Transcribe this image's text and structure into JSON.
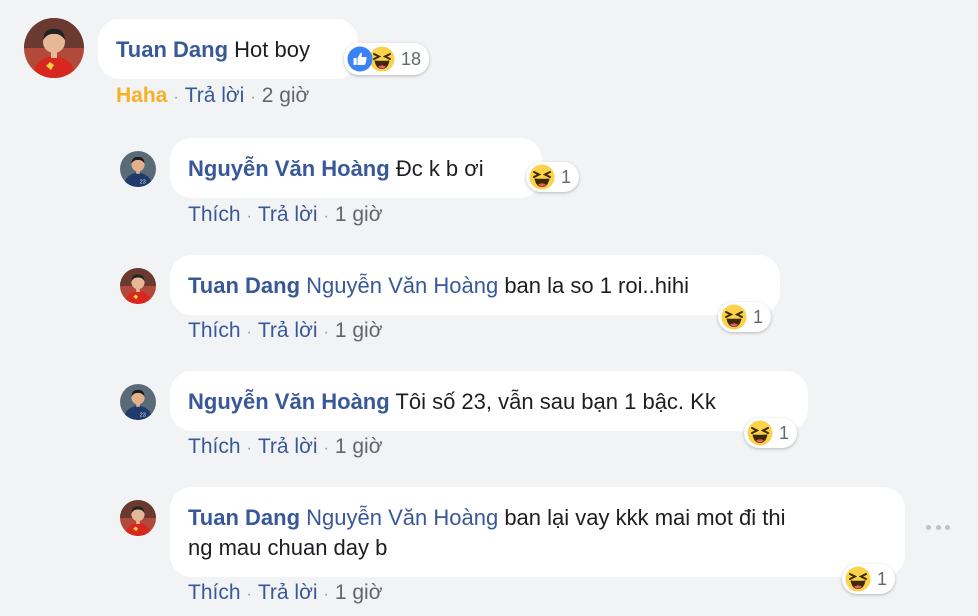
{
  "comment": {
    "author": "Tuan Dang",
    "text": "Hot boy",
    "reaction_count": "18",
    "actions": {
      "react": "Haha",
      "reply": "Trả lời",
      "time": "2 giờ"
    }
  },
  "replies": [
    {
      "author": "Nguyễn Văn Hoàng",
      "mention": "",
      "text": "Đc k b ơi",
      "reaction_count": "1",
      "actions": {
        "like": "Thích",
        "reply": "Trả lời",
        "time": "1 giờ"
      }
    },
    {
      "author": "Tuan Dang",
      "mention": "Nguyễn Văn Hoàng",
      "text": "ban la so 1 roi..hihi",
      "reaction_count": "1",
      "actions": {
        "like": "Thích",
        "reply": "Trả lời",
        "time": "1 giờ"
      }
    },
    {
      "author": "Nguyễn Văn Hoàng",
      "mention": "",
      "text": "Tôi số 23, vẫn sau bạn 1 bậc. Kk",
      "reaction_count": "1",
      "actions": {
        "like": "Thích",
        "reply": "Trả lời",
        "time": "1 giờ"
      }
    },
    {
      "author": "Tuan Dang",
      "mention": "Nguyễn Văn Hoàng",
      "text_line1": "ban lại vay kkk mai mot đi thi",
      "text_line2": "ng mau chuan day b",
      "reaction_count": "1",
      "actions": {
        "like": "Thích",
        "reply": "Trả lời",
        "time": "1 giờ"
      }
    }
  ],
  "icons": {
    "like": "like-icon",
    "haha": "haha-icon",
    "more": "more-options-icon"
  },
  "colors": {
    "name": "#385898",
    "haha_label": "#f7b125",
    "background": "#f2f3f5",
    "bubble": "#ffffff"
  }
}
